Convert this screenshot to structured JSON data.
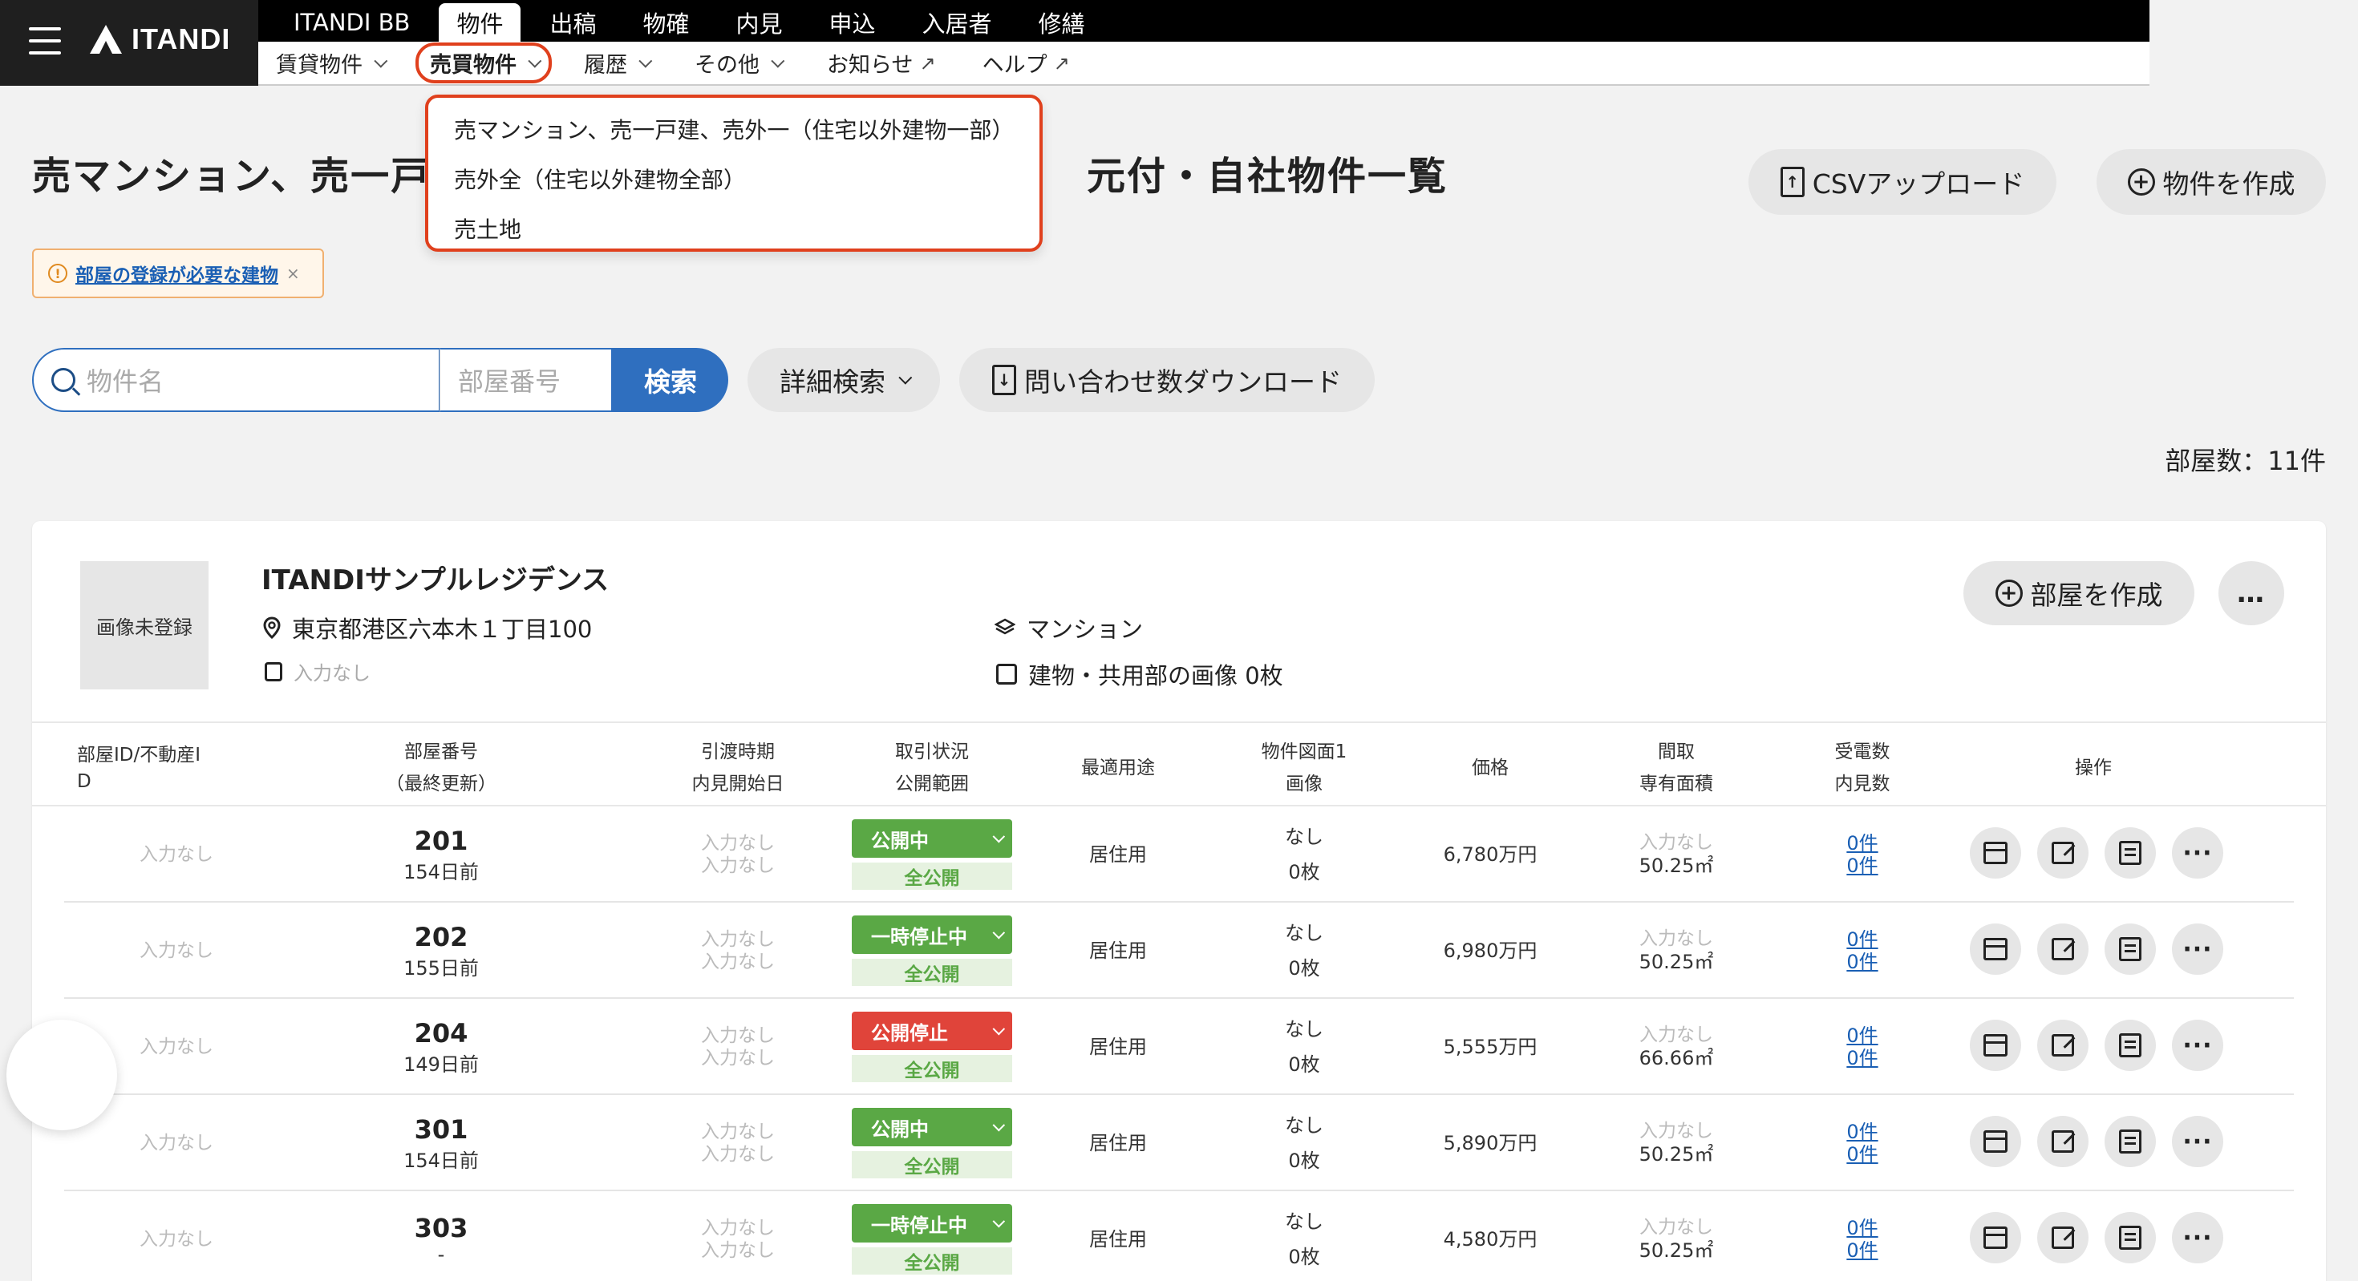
{
  "brand": {
    "logo_text": "ITANDI"
  },
  "main_nav": [
    "ITANDI BB",
    "物件",
    "出稿",
    "物確",
    "内見",
    "申込",
    "入居者",
    "修繕"
  ],
  "sub_nav": {
    "rent": "賃貸物件",
    "sale": "売買物件",
    "history": "履歴",
    "other": "その他",
    "news": "お知らせ",
    "help": "ヘルプ"
  },
  "dropdown": {
    "options": [
      "売マンション、売一戸建、売外一（住宅以外建物一部）",
      "売外全（住宅以外建物全部）",
      "売土地"
    ]
  },
  "page": {
    "title_left": "売マンション、売一戸",
    "title_right": "元付・自社物件一覧",
    "csv_upload": "CSVアップロード",
    "create_property": "物件を作成",
    "alert_text": "部屋の登録が必要な建物",
    "alert_close": "×",
    "search_placeholder": "物件名",
    "room_placeholder": "部屋番号",
    "search_button": "検索",
    "detail_search": "詳細検索",
    "download_inquiries": "問い合わせ数ダウンロード",
    "room_count": "部屋数：11件"
  },
  "property": {
    "image_placeholder": "画像未登録",
    "name": "ITANDIサンプルレジデンス",
    "address": "東京都港区六本木１丁目100",
    "station": "入力なし",
    "type": "マンション",
    "images": "建物・共用部の画像 0枚",
    "create_room": "部屋を作成",
    "more": "…"
  },
  "table": {
    "headers": {
      "room_id_1": "部屋ID/不動産I",
      "room_id_2": "D",
      "room_no_1": "部屋番号",
      "room_no_2": "（最終更新）",
      "handover_1": "引渡時期",
      "handover_2": "内見開始日",
      "status_1": "取引状況",
      "status_2": "公開範囲",
      "usage": "最適用途",
      "drawing_1": "物件図面1",
      "drawing_2": "画像",
      "price": "価格",
      "layout_1": "間取",
      "layout_2": "専有面積",
      "calls_1": "受電数",
      "calls_2": "内見数",
      "ops": "操作"
    },
    "rows": [
      {
        "id": "入力なし",
        "room": "201",
        "updated": "154日前",
        "handover": "入力なし",
        "viewing": "入力なし",
        "status": "公開中",
        "scope": "全公開",
        "usage": "居住用",
        "drawing": "なし",
        "images": "0枚",
        "price": "6,780万円",
        "layout": "入力なし",
        "area": "50.25㎡",
        "calls": "0件",
        "views": "0件"
      },
      {
        "id": "入力なし",
        "room": "202",
        "updated": "155日前",
        "handover": "入力なし",
        "viewing": "入力なし",
        "status": "一時停止中",
        "scope": "全公開",
        "usage": "居住用",
        "drawing": "なし",
        "images": "0枚",
        "price": "6,980万円",
        "layout": "入力なし",
        "area": "50.25㎡",
        "calls": "0件",
        "views": "0件"
      },
      {
        "id": "入力なし",
        "room": "204",
        "updated": "149日前",
        "handover": "入力なし",
        "viewing": "入力なし",
        "status": "公開停止",
        "scope": "全公開",
        "usage": "居住用",
        "drawing": "なし",
        "images": "0枚",
        "price": "5,555万円",
        "layout": "入力なし",
        "area": "66.66㎡",
        "calls": "0件",
        "views": "0件"
      },
      {
        "id": "入力なし",
        "room": "301",
        "updated": "154日前",
        "handover": "入力なし",
        "viewing": "入力なし",
        "status": "公開中",
        "scope": "全公開",
        "usage": "居住用",
        "drawing": "なし",
        "images": "0枚",
        "price": "5,890万円",
        "layout": "入力なし",
        "area": "50.25㎡",
        "calls": "0件",
        "views": "0件"
      },
      {
        "id": "入力なし",
        "room": "303",
        "updated": "-",
        "handover": "入力なし",
        "viewing": "入力なし",
        "status": "一時停止中",
        "scope": "全公開",
        "usage": "居住用",
        "drawing": "なし",
        "images": "0枚",
        "price": "4,580万円",
        "layout": "入力なし",
        "area": "50.25㎡",
        "calls": "0件",
        "views": "0件"
      }
    ]
  },
  "colors": {
    "accent_blue": "#2f6fbf",
    "status_green": "#5aa845",
    "status_red": "#e0443a",
    "highlight": "#e0401d"
  }
}
